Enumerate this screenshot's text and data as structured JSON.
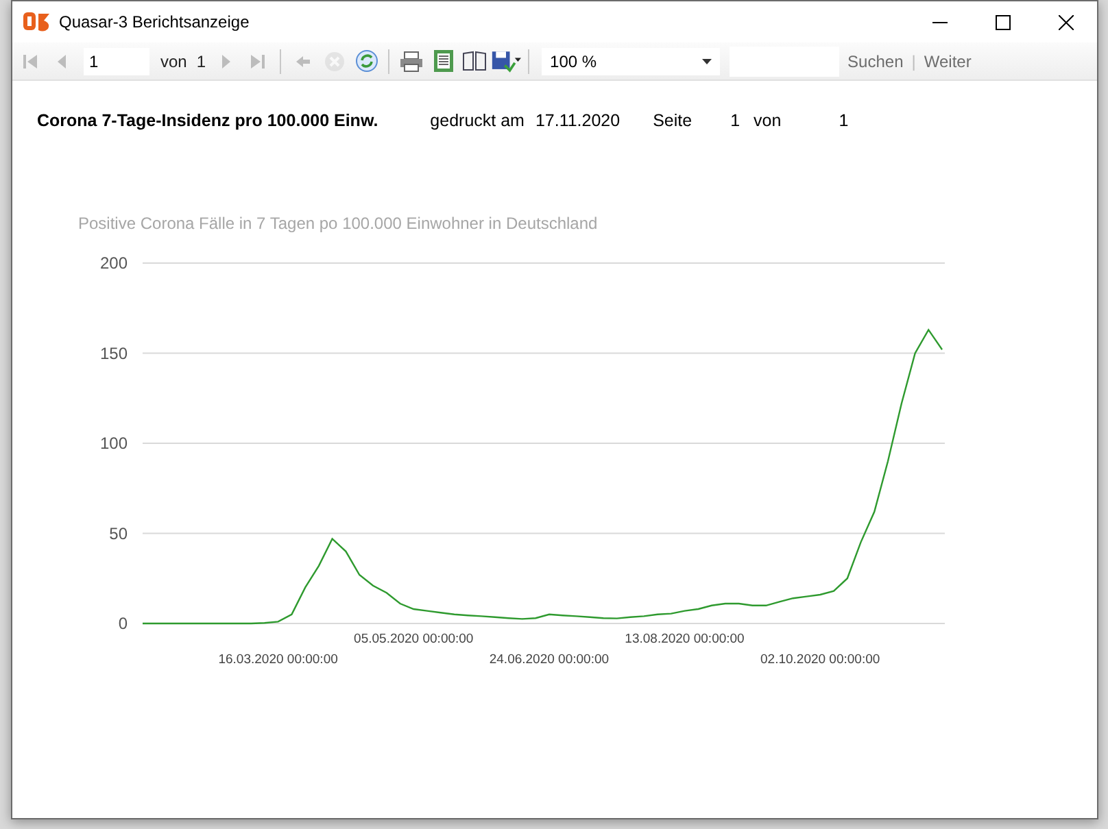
{
  "window": {
    "title": "Quasar-3 Berichtsanzeige"
  },
  "toolbar": {
    "buttons": [
      {
        "kind": "first",
        "disabled": true
      },
      {
        "kind": "prev",
        "disabled": true
      }
    ],
    "page_input": "1",
    "of_label": "von",
    "page_total": "1",
    "buttons_after": [
      {
        "kind": "next",
        "disabled": true
      },
      {
        "kind": "last",
        "disabled": true
      },
      {
        "kind": "back",
        "disabled": true
      },
      {
        "kind": "stop",
        "disabled": true
      },
      {
        "kind": "refresh",
        "disabled": false
      },
      {
        "kind": "print",
        "disabled": false
      },
      {
        "kind": "layout",
        "disabled": false
      },
      {
        "kind": "pagesetup",
        "disabled": false
      },
      {
        "kind": "save",
        "disabled": false
      }
    ],
    "zoom": "100 %",
    "find_label": "Suchen",
    "separator": "|",
    "next_label": "Weiter"
  },
  "report": {
    "title": "Corona 7-Tage-Insidenz pro 100.000 Einw.",
    "printed_label": "gedruckt am",
    "printed_date": "17.11.2020",
    "page_label": "Seite",
    "page_number": "1",
    "of_label": "von",
    "page_count": "1",
    "chart_data": {
      "type": "line",
      "title": "Positive Corona Fälle in 7 Tagen po 100.000 Einwohner in Deutschland",
      "categories": [
        null,
        null,
        null,
        null,
        null,
        null,
        null,
        null,
        null,
        null,
        "16.03.2020 00:00:00",
        null,
        null,
        null,
        null,
        null,
        null,
        null,
        null,
        null,
        "05.05.2020 00:00:00",
        null,
        null,
        null,
        null,
        null,
        null,
        null,
        null,
        null,
        "24.06.2020 00:00:00",
        null,
        null,
        null,
        null,
        null,
        null,
        null,
        null,
        null,
        "13.08.2020 00:00:00",
        null,
        null,
        null,
        null,
        null,
        null,
        null,
        null,
        null,
        "02.10.2020 00:00:00",
        null,
        null,
        null,
        null,
        null,
        null,
        null,
        null,
        null
      ],
      "series": [
        {
          "color": "#2e9a2e",
          "values": [
            0,
            0,
            0,
            0,
            0,
            0,
            0,
            0,
            0,
            0.3,
            1,
            5,
            20,
            32,
            47,
            40,
            27,
            21,
            17,
            11,
            8,
            7,
            6,
            5,
            4.5,
            4,
            3.5,
            3,
            2.5,
            3,
            5,
            4.5,
            4,
            3.5,
            3,
            2.8,
            3.5,
            4,
            5,
            5.5,
            7,
            8,
            10,
            11,
            11,
            10,
            10,
            12,
            14,
            15,
            16,
            18,
            25,
            45,
            62,
            90,
            122,
            150,
            163,
            152
          ]
        }
      ],
      "grid": true,
      "ylim": [
        0,
        200
      ],
      "yticks": [
        0,
        50,
        100,
        150,
        200
      ]
    }
  }
}
